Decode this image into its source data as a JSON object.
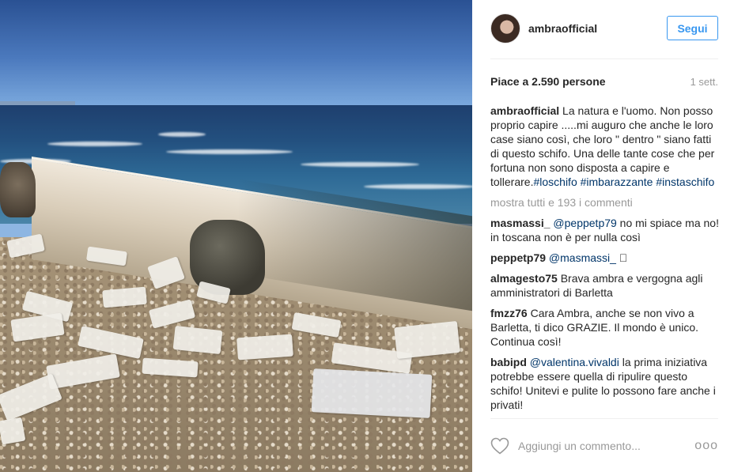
{
  "post": {
    "username": "ambraofficial",
    "follow_label": "Segui",
    "likes_text": "Piace a 2.590 persone",
    "time_text": "1 sett."
  },
  "caption": {
    "user": "ambraofficial",
    "text": "La natura e l'uomo. Non posso proprio capire .....mi auguro che anche le loro case siano così, che loro \" dentro \" siano fatti di questo schifo. Una delle tante cose che per fortuna non sono disposta a capire e tollerare.",
    "tag1": "#loschifo",
    "tag2": "#imbarazzante",
    "tag3": "#instaschifo"
  },
  "more_comments": "mostra tutti e 193 i commenti",
  "comments": [
    {
      "user": "masmassi_",
      "mention": "@peppetp79",
      "text": " no mi spiace ma no! in toscana non è per nulla così"
    },
    {
      "user": "peppetp79",
      "mention": "@masmassi_",
      "text": " 🏻"
    },
    {
      "user": "almagesto75",
      "mention": "",
      "text": "Brava ambra e vergogna agli amministratori di Barletta"
    },
    {
      "user": "fmzz76",
      "mention": "",
      "text": "Cara Ambra, anche se non vivo a Barletta, ti dico GRAZIE. Il mondo è unico. Continua così!"
    },
    {
      "user": "babipd",
      "mention": "@valentina.vivaldi",
      "text": " la prima iniziativa potrebbe essere quella di ripulire questo schifo! Unitevi e pulite lo possono fare anche i privati!"
    }
  ],
  "footer": {
    "comment_placeholder": "Aggiungi un commento...",
    "more_dots": "ooo"
  },
  "colors": {
    "link": "#003569",
    "follow": "#3897f0",
    "muted": "#999999"
  }
}
